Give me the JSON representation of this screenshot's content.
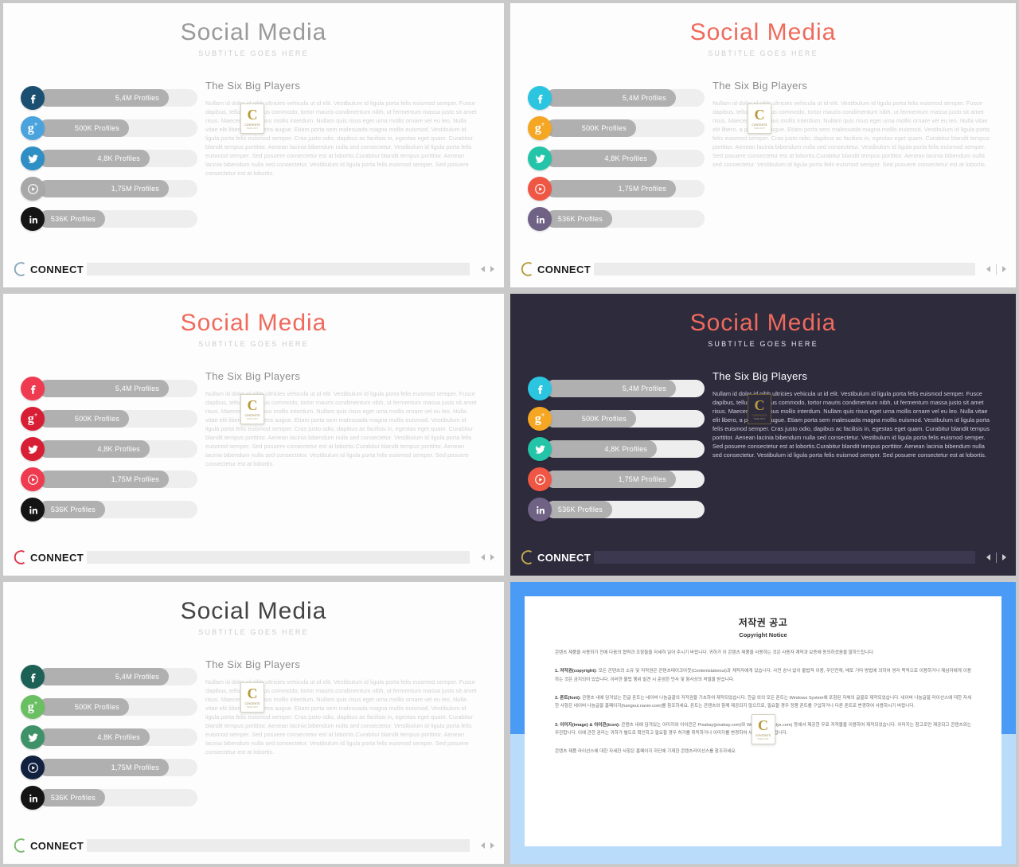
{
  "deck": {
    "title": "Social Media",
    "subtitle": "SUBTITLE GOES HERE",
    "heading": "The Six Big Players",
    "body": "Nullam id dolor id nibh ultricies vehicula ut id elit. Vestibulum id ligula porta felis euismod semper. Fusce dapibus, tellus ac cursus commodo, tortor mauris condimentum nibh, ut fermentum massa justo sit amet risus. Maecenas faucibus mollis interdum. Nullam quis risus eget urna mollis ornare vel eu leo. Nulla vitae elit libero, a pharetra augue. Etiam porta sem malesuada magna mollis euismod. Vestibulum id ligula porta felis euismod semper. Cras justo odio, dapibus ac facilisis in, egestas eget quam. Curabitur blandit tempus porttitor. Aenean lacinia bibendum nulla sed consectetur. Vestibulum id ligula porta felis euismod semper. Sed posuere consectetur est at lobortis.Curabitur blandit tempus porttitor. Aenean lacinia bibendum nulla sed consectetur. Vestibulum id ligula porta felis euismod semper. Sed posuere consectetur est at lobortis."
  },
  "bars": [
    {
      "network": "facebook",
      "icon": "facebook-icon",
      "label": "5,4M Profiles",
      "percent": 82
    },
    {
      "network": "googleplus",
      "icon": "google-plus-icon",
      "label": "500K Profiles",
      "percent": 57
    },
    {
      "network": "twitter",
      "icon": "twitter-icon",
      "label": "4,8K Profiles",
      "percent": 70
    },
    {
      "network": "vimeo",
      "icon": "play-circle-icon",
      "label": "1,75M Profiles",
      "percent": 82
    },
    {
      "network": "linkedin",
      "icon": "linkedin-icon",
      "label": "536K Profiles",
      "percent": 42
    }
  ],
  "palettes": {
    "slide1": [
      "#1b4f72",
      "#4ba3dd",
      "#2f8fc4",
      "#a8a8a8",
      "#151515"
    ],
    "slide2": [
      "#2cc5e0",
      "#f5a623",
      "#23c4a8",
      "#ef5644",
      "#6f6284"
    ],
    "slide3": [
      "#ef3b4f",
      "#d81e34",
      "#d81e34",
      "#ef3b4f",
      "#141414"
    ],
    "slide4": [
      "#2cc5e0",
      "#f5a623",
      "#23c4a8",
      "#ef5644",
      "#6f6284"
    ],
    "slide5": [
      "#1d6156",
      "#6bbf63",
      "#3f9168",
      "#12203f",
      "#141414"
    ]
  },
  "colors": {
    "title_gray": "#9a9a9a",
    "title_coral": "#ef6a5c",
    "title_dark": "#444444",
    "dark_bg": "#2e2b3d",
    "track": "#eeeeee",
    "fill": "#b0b0b0",
    "blue_border": "#4a9bf5",
    "blue_border_light": "#b9dcfb",
    "gold": "#b89a3c"
  },
  "footer": {
    "logo_text": "CONNECT",
    "logo_arc": "c-arc-icon",
    "nav_prev": "nav-prev-icon",
    "nav_next": "nav-next-icon"
  },
  "badge": {
    "letter": "C",
    "line1": "CONTENTS",
    "line2": "TAKE  OUT"
  },
  "copyright": {
    "title_ko": "저작권 공고",
    "title_en": "Copyright Notice",
    "intro": "콘텐츠 제품을 사용하기 전에 다음의 협약과 조항들을 자세히 읽어 주시기 바랍니다. 귀하가 이 콘텐츠 제품을 사용하는 것은 사용자 계약과 보증에 동의하셨음을 말하드립니다.",
    "s1_label": "1. 저작권(copyright):",
    "s1": " 모든 콘텐츠의 소유 및 저작권은 콘텐츠테이크아웃(Contentstakeout)과 제작자에게 있습니다. 사전 승낙 없이 불법적 이용, 무단전재, 배포 기타 방법에 의하여 영리 목적으로 이용하거나 제삼자에게 이용하는 것은 금지되어 있습니다. 이러한 불법 행위 발견 시 준엄한 민사 및 형사상의 처벌을 받습니다.",
    "s2_label": "2. 폰트(font):",
    "s2": " 콘텐츠 내에 담겨있는 한글 폰트는 네이버 나눔글꼴의 저작권을 기초하여 제작되었습니다. 한글 외의 모든 폰트는 Windows System에 포함된 자체의 글꼴로 제작되었습니다. 네이버 나눔글꼴 라이선스에 대한 자세한 사항은 네이버 나눔글꼴 홈페이지(hangeul.naver.com)를 참조하세요. 폰트는 콘텐츠와 함께 제공되지 않으므로, 필요할 경우 정품 폰트를 구입하거나 다른 폰트로 변경하여 사용하시기 바랍니다.",
    "s3_label": "3. 이미지(image) & 아이콘(icon):",
    "s3": " 콘텐츠 내에 담겨있는 이미지와 아이콘은 Pixabay(pixabay.com)와 Webalys(webalys.com) 등에서 제공한 무료 저작물을 이용하여 제작되었습니다. 이미지는 참고로만 제공되고 콘텐츠와는 무관합니다. 이에 관한 권리는 귀하가 별도로 확인하고 필요할 경우 허가를 취득하거나 이미지를 변경하여 사용하시기 바랍니다.",
    "outro": "콘텐츠 제품 라이선스에 대한 자세한 사항은 홈페이지 하단에 기재한 콘텐츠라이선스를 참조하세요."
  }
}
